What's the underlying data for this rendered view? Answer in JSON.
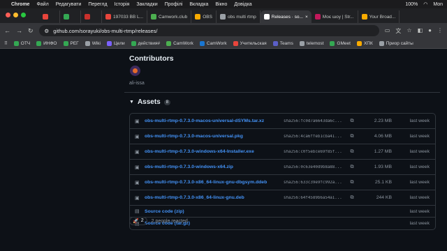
{
  "menubar": {
    "app": "Chrome",
    "menus": [
      "Файл",
      "Редагувати",
      "Переглд",
      "Історія",
      "Закладки",
      "Профілі",
      "Вкладка",
      "Вікно",
      "Довідка"
    ],
    "battery": "100%",
    "time": "Mon"
  },
  "tabs": [
    {
      "label": "",
      "color": "#e8453c"
    },
    {
      "label": "",
      "color": "#34a853"
    },
    {
      "label": "",
      "color": "#c9302c"
    },
    {
      "label": "197033 BB L...",
      "color": "#e8453c"
    },
    {
      "label": "Camwork.club",
      "color": "#4caf50"
    },
    {
      "label": "OBS",
      "color": "#f9ab00"
    },
    {
      "label": "obs multi rtmp",
      "color": "#9aa0a6"
    },
    {
      "label": "Releases · so...",
      "color": "#ffffff"
    },
    {
      "label": "Моє шоу | Str...",
      "color": "#c2185b"
    },
    {
      "label": "Your Broad...",
      "color": "#f9ab00"
    }
  ],
  "address": {
    "url": "github.com/sorayuki/obs-multi-rtmp/releases/"
  },
  "bookmarks": [
    {
      "label": "ОТЧ",
      "color": "#34a853"
    },
    {
      "label": "ИНФО",
      "color": "#34a853"
    },
    {
      "label": "РЕГ",
      "color": "#34a853"
    },
    {
      "label": "Wiki",
      "color": "#9aa0a6"
    },
    {
      "label": "Цели",
      "color": "#7b61ff"
    },
    {
      "label": "действия#",
      "color": "#34a853"
    },
    {
      "label": "CamWork",
      "color": "#4caf50"
    },
    {
      "label": "CamWork",
      "color": "#1976d2"
    },
    {
      "label": "Учительская",
      "color": "#e8453c"
    },
    {
      "label": "Teams",
      "color": "#5b5fc7"
    },
    {
      "label": "telemost",
      "color": "#9aa0a6"
    },
    {
      "label": "GMeet",
      "color": "#34a853"
    },
    {
      "label": "ХПК",
      "color": "#f9ab00"
    },
    {
      "label": "Приор сайты",
      "color": "#9aa0a6"
    }
  ],
  "contributors": {
    "title": "Contributors",
    "name": "ali-issa"
  },
  "assets": {
    "title": "Assets",
    "count": "8",
    "items": [
      {
        "name": "obs-multi-rtmp-0.7.3.0-macos-universal-dSYMs.tar.xz",
        "sha": "sha256:fc0d7a6643da6c...",
        "size": "2.23 MB",
        "date": "last week",
        "kind": "package"
      },
      {
        "name": "obs-multi-rtmp-0.7.3.0-macos-universal.pkg",
        "sha": "sha256:4ca6ffeb1cba41...",
        "size": "4.06 MB",
        "date": "last week",
        "kind": "package"
      },
      {
        "name": "obs-multi-rtmp-0.7.3.0-windows-x64-Installer.exe",
        "sha": "sha256:c0f5ebce69f85f...",
        "size": "1.27 MB",
        "date": "last week",
        "kind": "package"
      },
      {
        "name": "obs-multi-rtmp-0.7.3.0-windows-x64.zip",
        "sha": "sha256:0c63e40d9b8a88...",
        "size": "1.93 MB",
        "date": "last week",
        "kind": "package"
      },
      {
        "name": "obs-multi-rtmp-0.7.3.0-x86_64-linux-gnu-dbgsym.ddeb",
        "sha": "sha256:633c39e9fc992a...",
        "size": "25.1 KB",
        "date": "last week",
        "kind": "package"
      },
      {
        "name": "obs-multi-rtmp-0.7.3.0-x86_64-linux-gnu.deb",
        "sha": "sha256:64f4589b6a54a1...",
        "size": "244 KB",
        "date": "last week",
        "kind": "package"
      },
      {
        "name": "Source code (zip)",
        "sha": "",
        "size": "",
        "date": "last week",
        "kind": "source"
      },
      {
        "name": "Source code (tar.gz)",
        "sha": "",
        "size": "",
        "date": "last week",
        "kind": "source"
      }
    ]
  },
  "reactions": {
    "emoji": "🚀",
    "count": "2",
    "text": "2 people reacted"
  }
}
